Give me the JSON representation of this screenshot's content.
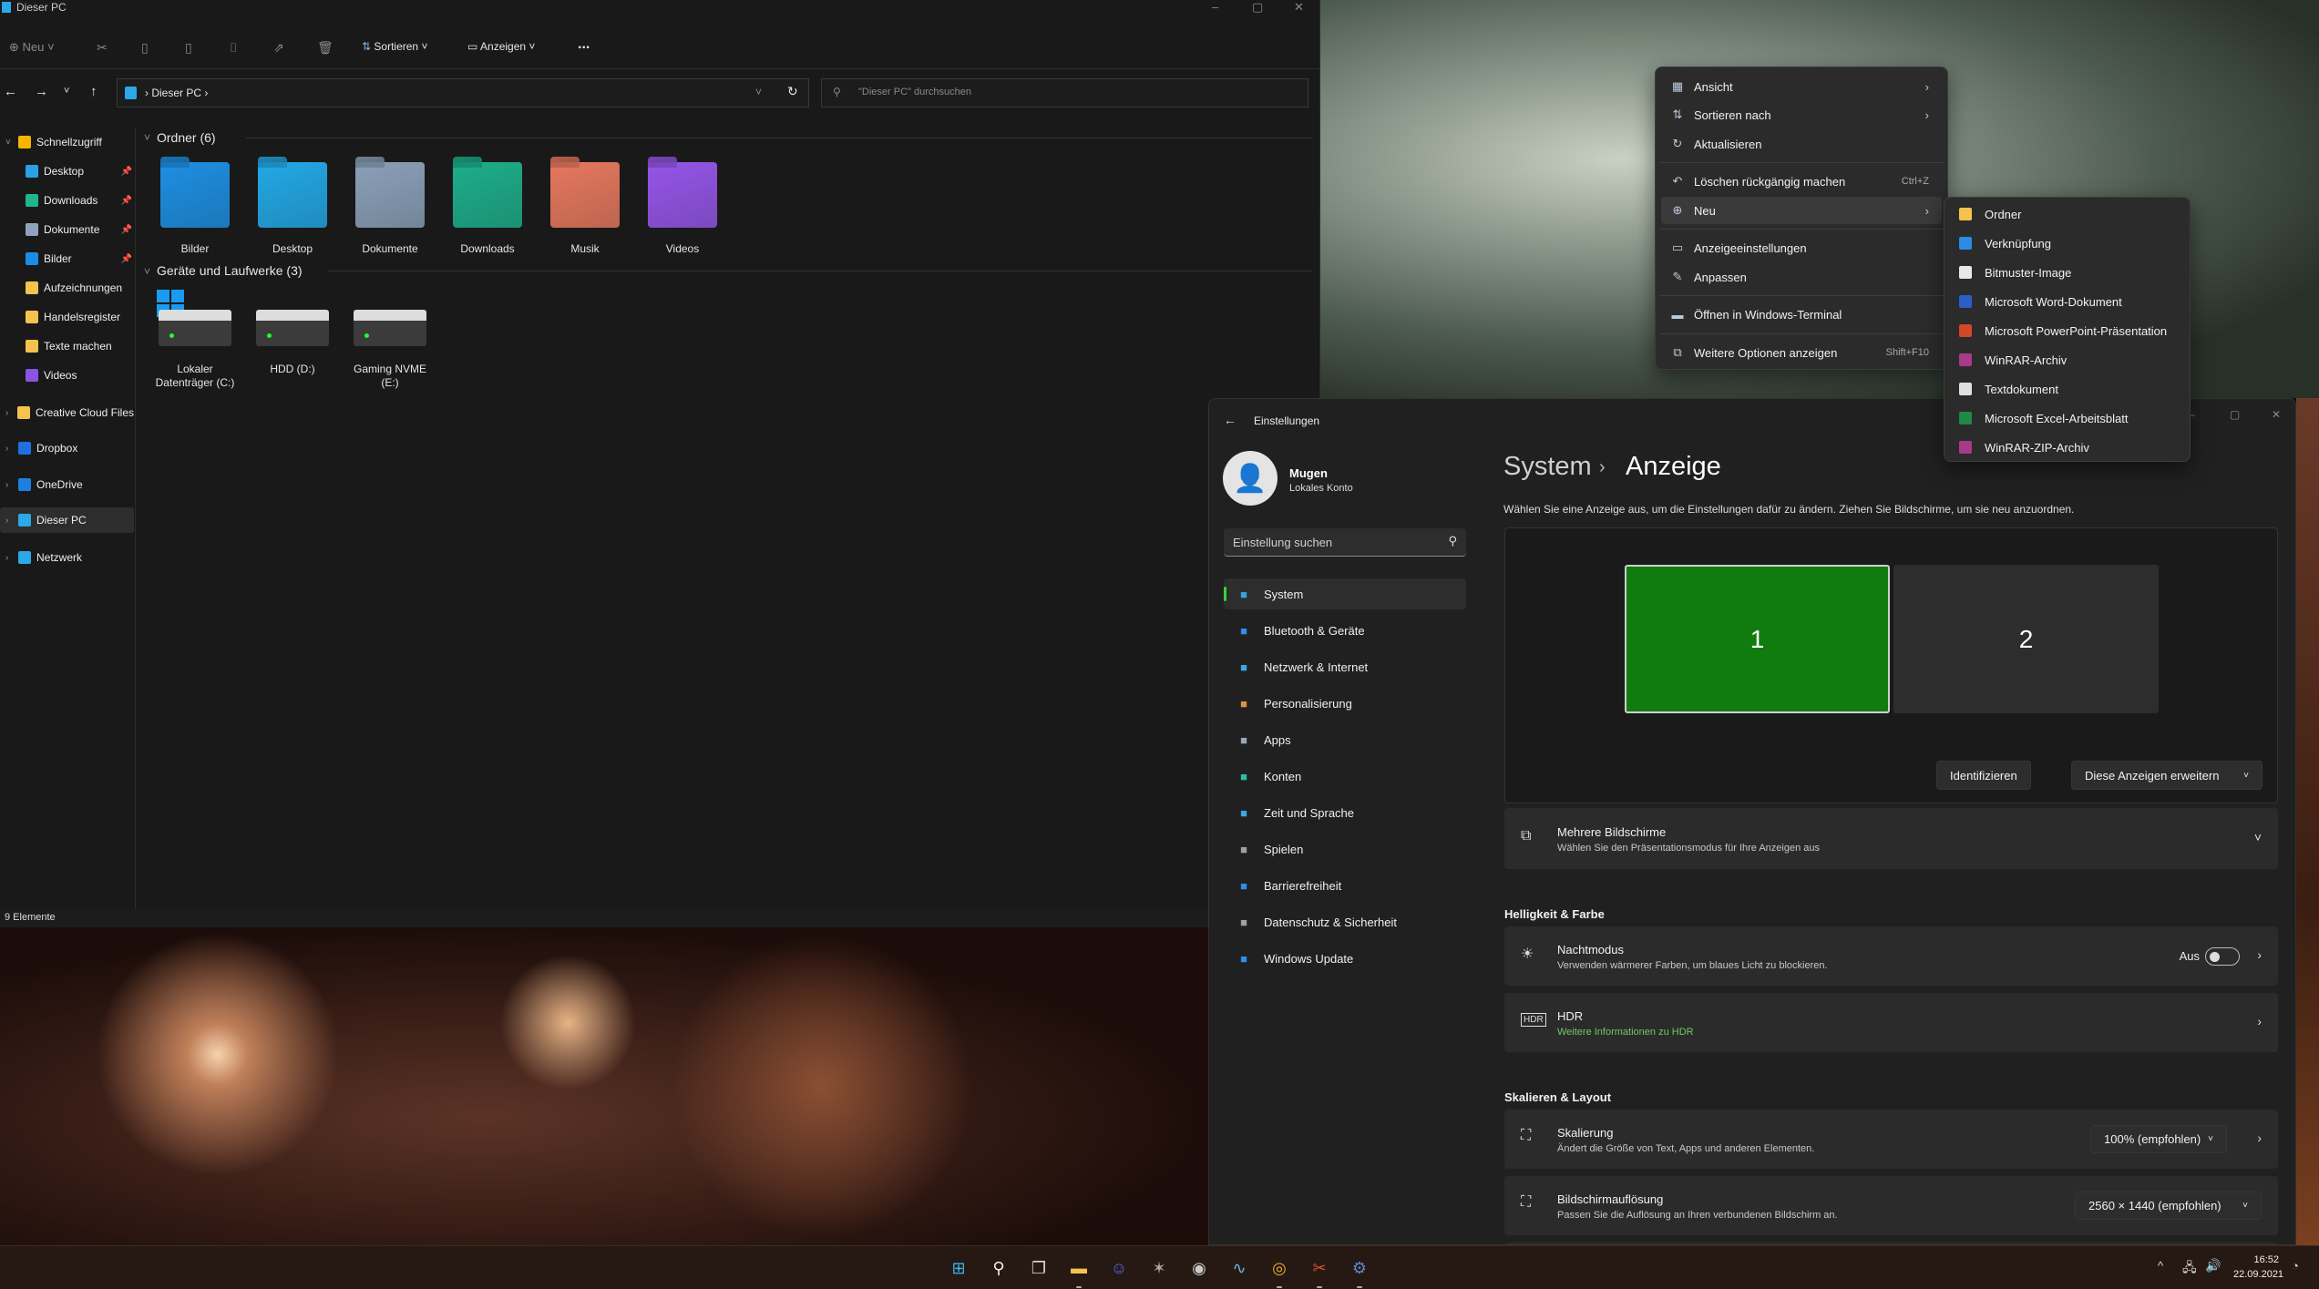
{
  "explorer": {
    "title": "Dieser PC",
    "toolbar": {
      "new": "Neu",
      "sort": "Sortieren",
      "view": "Anzeigen",
      "more": "..."
    },
    "address": {
      "crumb": "Dieser PC",
      "search_placeholder": "\"Dieser PC\" durchsuchen"
    },
    "sidebar": [
      {
        "label": "Schnellzugriff",
        "icon": "star-icon",
        "color": "#f7b500",
        "pinned": false,
        "indent": false,
        "expander": true
      },
      {
        "label": "Desktop",
        "icon": "desktop-icon",
        "color": "#2aa0e8",
        "pinned": true,
        "indent": true
      },
      {
        "label": "Downloads",
        "icon": "download-icon",
        "color": "#1fb58f",
        "pinned": true,
        "indent": true
      },
      {
        "label": "Dokumente",
        "icon": "documents-icon",
        "color": "#8fa4bb",
        "pinned": true,
        "indent": true
      },
      {
        "label": "Bilder",
        "icon": "pictures-icon",
        "color": "#1a8ee6",
        "pinned": true,
        "indent": true
      },
      {
        "label": "Aufzeichnungen",
        "icon": "folder-icon",
        "color": "#f5c24d",
        "pinned": false,
        "indent": true
      },
      {
        "label": "Handelsregister",
        "icon": "folder-icon",
        "color": "#f5c24d",
        "pinned": false,
        "indent": true
      },
      {
        "label": "Texte machen",
        "icon": "folder-icon",
        "color": "#f5c24d",
        "pinned": false,
        "indent": true
      },
      {
        "label": "Videos",
        "icon": "videos-icon",
        "color": "#8c52e0",
        "pinned": false,
        "indent": true
      },
      {
        "label": "Creative Cloud Files",
        "icon": "creative-cloud-icon",
        "color": "#f5c24d",
        "expander": true
      },
      {
        "label": "Dropbox",
        "icon": "dropbox-icon",
        "color": "#1f6fe0",
        "expander": true
      },
      {
        "label": "OneDrive",
        "icon": "onedrive-icon",
        "color": "#1f7fe0",
        "expander": true
      },
      {
        "label": "Dieser PC",
        "icon": "computer-icon",
        "color": "#2aa8e8",
        "expander": true,
        "selected": true
      },
      {
        "label": "Netzwerk",
        "icon": "network-icon",
        "color": "#2aa8e8",
        "expander": true
      }
    ],
    "folders_header": "Ordner (6)",
    "folders": [
      {
        "label": "Bilder",
        "color": "#1d8fe2"
      },
      {
        "label": "Desktop",
        "color": "#22a8e6"
      },
      {
        "label": "Dokumente",
        "color": "#8aa0b8"
      },
      {
        "label": "Downloads",
        "color": "#1cae8a"
      },
      {
        "label": "Musik",
        "color": "#e6785e"
      },
      {
        "label": "Videos",
        "color": "#9555e8"
      }
    ],
    "drives_header": "Geräte und Laufwerke (3)",
    "drives": [
      "Lokaler Datenträger (C:)",
      "HDD (D:)",
      "Gaming NVME (E:)"
    ],
    "status": "9 Elemente"
  },
  "context_menu": {
    "items": [
      {
        "label": "Ansicht",
        "icon": "view-grid-icon",
        "glyph": "▦",
        "submenu": true
      },
      {
        "label": "Sortieren nach",
        "icon": "sort-icon",
        "glyph": "⇅",
        "submenu": true
      },
      {
        "label": "Aktualisieren",
        "icon": "refresh-icon",
        "glyph": "↻"
      },
      {
        "label": "Löschen rückgängig machen",
        "icon": "undo-icon",
        "glyph": "↶",
        "shortcut": "Ctrl+Z",
        "sep_before": true
      },
      {
        "label": "Neu",
        "icon": "new-plus-icon",
        "glyph": "⊕",
        "submenu": true,
        "highlighted": true
      },
      {
        "label": "Anzeigeeinstellungen",
        "icon": "display-settings-icon",
        "glyph": "▭",
        "sep_before": true
      },
      {
        "label": "Anpassen",
        "icon": "brush-icon",
        "glyph": "✎"
      },
      {
        "label": "Öffnen in Windows-Terminal",
        "icon": "terminal-icon",
        "glyph": "▬",
        "sep_before": true
      },
      {
        "label": "Weitere Optionen anzeigen",
        "icon": "more-options-icon",
        "glyph": "⧉",
        "shortcut": "Shift+F10",
        "sep_before": true
      }
    ],
    "submenu": [
      {
        "label": "Ordner",
        "icon": "folder-icon",
        "color": "#f5c24d"
      },
      {
        "label": "Verknüpfung",
        "icon": "shortcut-icon",
        "color": "#2b8ce6"
      },
      {
        "label": "Bitmuster-Image",
        "icon": "bitmap-icon",
        "color": "#e8e8e8"
      },
      {
        "label": "Microsoft Word-Dokument",
        "icon": "word-icon",
        "color": "#2b5fc8"
      },
      {
        "label": "Microsoft PowerPoint-Präsentation",
        "icon": "powerpoint-icon",
        "color": "#d24726"
      },
      {
        "label": "WinRAR-Archiv",
        "icon": "winrar-icon",
        "color": "#a83a8a"
      },
      {
        "label": "Textdokument",
        "icon": "text-document-icon",
        "color": "#e0e0e0"
      },
      {
        "label": "Microsoft Excel-Arbeitsblatt",
        "icon": "excel-icon",
        "color": "#1e8a45"
      },
      {
        "label": "WinRAR-ZIP-Archiv",
        "icon": "winrar-zip-icon",
        "color": "#a83a8a"
      }
    ]
  },
  "settings": {
    "title": "Einstellungen",
    "user": {
      "name": "Mugen",
      "account": "Lokales Konto"
    },
    "search_placeholder": "Einstellung suchen",
    "nav": [
      {
        "label": "System",
        "icon": "system-icon",
        "color": "#3aa0e0",
        "selected": true
      },
      {
        "label": "Bluetooth & Geräte",
        "icon": "bluetooth-icon",
        "color": "#2f8fe8"
      },
      {
        "label": "Netzwerk & Internet",
        "icon": "network-wifi-icon",
        "color": "#3aa8e8"
      },
      {
        "label": "Personalisierung",
        "icon": "personalization-brush-icon",
        "color": "#e09040"
      },
      {
        "label": "Apps",
        "icon": "apps-icon",
        "color": "#9aa8b8"
      },
      {
        "label": "Konten",
        "icon": "accounts-icon",
        "color": "#2bc0a0"
      },
      {
        "label": "Zeit und Sprache",
        "icon": "time-language-icon",
        "color": "#3aa8e8"
      },
      {
        "label": "Spielen",
        "icon": "gaming-icon",
        "color": "#a0a0a0"
      },
      {
        "label": "Barrierefreiheit",
        "icon": "accessibility-icon",
        "color": "#2f8fe8"
      },
      {
        "label": "Datenschutz & Sicherheit",
        "icon": "shield-icon",
        "color": "#a0a0a0"
      },
      {
        "label": "Windows Update",
        "icon": "windows-update-icon",
        "color": "#2f8fe8"
      }
    ],
    "breadcrumb": {
      "parent": "System",
      "current": "Anzeige"
    },
    "description": "Wählen Sie eine Anzeige aus, um die Einstellungen dafür zu ändern. Ziehen Sie Bildschirme, um sie neu anzuordnen.",
    "monitors": [
      {
        "label": "1",
        "selected": true,
        "color": "#107c10"
      },
      {
        "label": "2",
        "selected": false,
        "color": "#2d2d2d"
      }
    ],
    "identify": "Identifizieren",
    "extend": "Diese Anzeigen erweitern",
    "multi": {
      "title": "Mehrere Bildschirme",
      "subtitle": "Wählen Sie den Präsentationsmodus für Ihre Anzeigen aus"
    },
    "section_brightness": "Helligkeit & Farbe",
    "night": {
      "title": "Nachtmodus",
      "subtitle": "Verwenden wärmerer Farben, um blaues Licht zu blockieren.",
      "state": "Aus",
      "on": false
    },
    "hdr": {
      "title": "HDR",
      "link": "Weitere Informationen zu HDR",
      "link_color": "#6ccb5f"
    },
    "section_layout": "Skalieren & Layout",
    "scale": {
      "title": "Skalierung",
      "subtitle": "Ändert die Größe von Text, Apps und anderen Elementen.",
      "value": "100% (empfohlen)"
    },
    "resolution": {
      "title": "Bildschirmauflösung",
      "subtitle": "Passen Sie die Auflösung an Ihren verbundenen Bildschirm an.",
      "value": "2560 × 1440 (empfohlen)"
    }
  },
  "taskbar": {
    "apps": [
      {
        "name": "start-icon",
        "glyph": "⊞",
        "color": "#3ab4f2"
      },
      {
        "name": "search-icon",
        "glyph": "⚲",
        "color": "#eee"
      },
      {
        "name": "task-view-icon",
        "glyph": "❐",
        "color": "#ddd"
      },
      {
        "name": "file-explorer-icon",
        "glyph": "▬",
        "color": "#f5c24d",
        "running": true
      },
      {
        "name": "discord-icon",
        "glyph": "☺",
        "color": "#5865f2"
      },
      {
        "name": "witcher-icon",
        "glyph": "✶",
        "color": "#aaa"
      },
      {
        "name": "obs-icon",
        "glyph": "◉",
        "color": "#ccc"
      },
      {
        "name": "resource-monitor-icon",
        "glyph": "∿",
        "color": "#6cb6e8"
      },
      {
        "name": "chrome-icon",
        "glyph": "◎",
        "color": "#e8b030",
        "running": true
      },
      {
        "name": "snipping-tool-icon",
        "glyph": "✂",
        "color": "#e05030",
        "running": true
      },
      {
        "name": "settings-gear-icon",
        "glyph": "⚙",
        "color": "#5a8ac8",
        "running": true
      }
    ],
    "time": "16:52",
    "date": "22.09.2021"
  }
}
